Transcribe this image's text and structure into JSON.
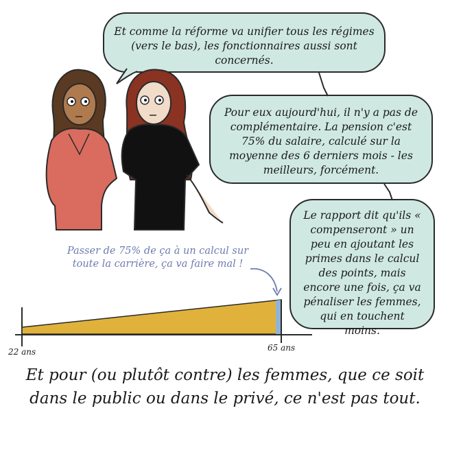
{
  "bubbles": {
    "top": "Et comme la réforme va unifier tous les régimes (vers le bas), les fonctionnaires aussi sont concernés.",
    "middle": "Pour eux aujourd'hui, il n'y a pas de complémentaire. La pension c'est 75% du salaire, calculé sur la moyenne des 6 derniers mois - les meilleurs, forcément.",
    "bottom": "Le rapport dit qu'ils « compenseront » un peu en ajoutant les primes dans le calcul des points, mais encore une fois, ça va pénaliser les femmes, qui en touchent moins."
  },
  "annotation": "Passer de 75% de ça à un calcul sur toute la carrière, ça va faire mal !",
  "chart": {
    "x_start_label": "22 ans",
    "x_end_label": "65 ans",
    "fill_color": "#e0b23b",
    "end_segment_color": "#8fb4d6"
  },
  "caption": "Et pour (ou plutôt contre) les femmes, que ce soit dans le public ou dans le privé, ce n'est pas tout.",
  "colors": {
    "bubble": "#cfe8e2",
    "annotation": "#6e7bb0",
    "shirt_left": "#d96c5e",
    "shirt_right": "#111111"
  }
}
